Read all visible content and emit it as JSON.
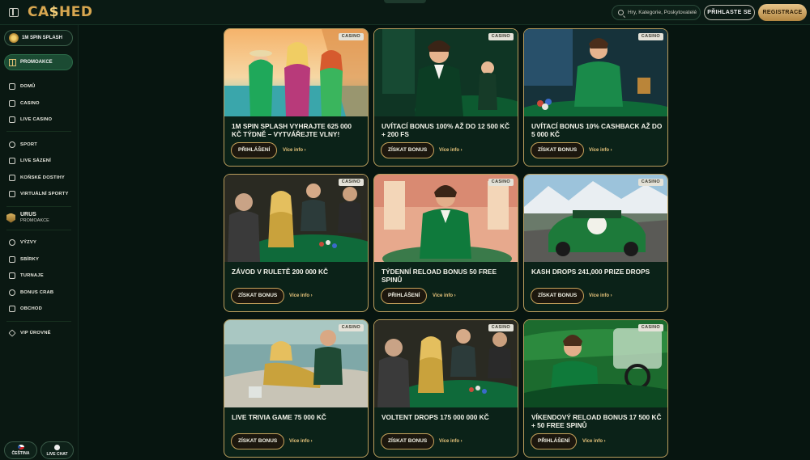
{
  "header": {
    "logo": "CA$HED",
    "logo_parts": [
      "CA",
      "$",
      "HED"
    ],
    "search_placeholder": "Hry, Kategorie, Poskytovatelé",
    "login_label": "PŘIHLASTE SE",
    "register_label": "REGISTRACE"
  },
  "sidebar": {
    "spin_label": "1M SPIN SPLASH",
    "promo_label": "PROMOAKCE",
    "group1": [
      {
        "label": "DOMŮ",
        "icon": "home-icon"
      },
      {
        "label": "CASINO",
        "icon": "cards-icon"
      },
      {
        "label": "LIVE CASINO",
        "icon": "live-icon"
      }
    ],
    "group2": [
      {
        "label": "SPORT",
        "icon": "ball-icon"
      },
      {
        "label": "LIVE SÁZENÍ",
        "icon": "live-bet-icon"
      },
      {
        "label": "KOŇSKÉ DOSTIHY",
        "icon": "horse-icon"
      },
      {
        "label": "VIRTUÁLNÍ SPORTY",
        "icon": "virtual-icon"
      }
    ],
    "urus": {
      "title": "URUS",
      "subtitle": "PROMOAKCE"
    },
    "group3": [
      {
        "label": "VÝZVY",
        "icon": "target-icon"
      },
      {
        "label": "SBÍRKY",
        "icon": "collection-icon"
      },
      {
        "label": "TURNAJE",
        "icon": "trophy-icon"
      },
      {
        "label": "BONUS CRAB",
        "icon": "crab-icon"
      },
      {
        "label": "OBCHOD",
        "icon": "shop-icon"
      }
    ],
    "vip_label": "VIP ÚROVNĚ",
    "language_label": "ČEŠTINA",
    "chat_label": "LIVE CHAT"
  },
  "cards": [
    {
      "tag": "CASINO",
      "title": "1M SPIN SPLASH VYHRAJTE 625 000 KČ TÝDNĚ – VYTVÁŘEJTE VLNY!",
      "button": "PŘIHLÁŠENÍ",
      "link": "Více info"
    },
    {
      "tag": "CASINO",
      "title": "UVÍTACÍ BONUS 100% AŽ DO 12 500 KČ + 200 FS",
      "button": "ZÍSKAT BONUS",
      "link": "Více info"
    },
    {
      "tag": "CASINO",
      "title": "UVÍTACÍ BONUS 10% CASHBACK AŽ DO 5 000 KČ",
      "button": "ZÍSKAT BONUS",
      "link": "Více info"
    },
    {
      "tag": "CASINO",
      "title": "ZÁVOD V RULETĚ 200 000 KČ",
      "button": "ZÍSKAT BONUS",
      "link": "Více info"
    },
    {
      "tag": "CASINO",
      "title": "TÝDENNÍ RELOAD BONUS 50 FREE SPINŮ",
      "button": "PŘIHLÁŠENÍ",
      "link": "Více info"
    },
    {
      "tag": "CASINO",
      "title": "KASH DROPS 241,000 PRIZE DROPS",
      "button": "ZÍSKAT BONUS",
      "link": "Více info"
    },
    {
      "tag": "CASINO",
      "title": "LIVE TRIVIA GAME 75 000 KČ",
      "button": "ZÍSKAT BONUS",
      "link": "Více info"
    },
    {
      "tag": "CASINO",
      "title": "VOLTENT DROPS 175 000 000 KČ",
      "button": "ZÍSKAT BONUS",
      "link": "Více info"
    },
    {
      "tag": "CASINO",
      "title": "VÍKENDOVÝ RELOAD BONUS 17 500 KČ + 50 FREE SPINŮ",
      "button": "PŘIHLÁŠENÍ",
      "link": "Více info"
    }
  ],
  "colors": {
    "accent": "#d8a750",
    "background": "#071510",
    "card": "#0b2218",
    "border": "#b99d5d"
  }
}
